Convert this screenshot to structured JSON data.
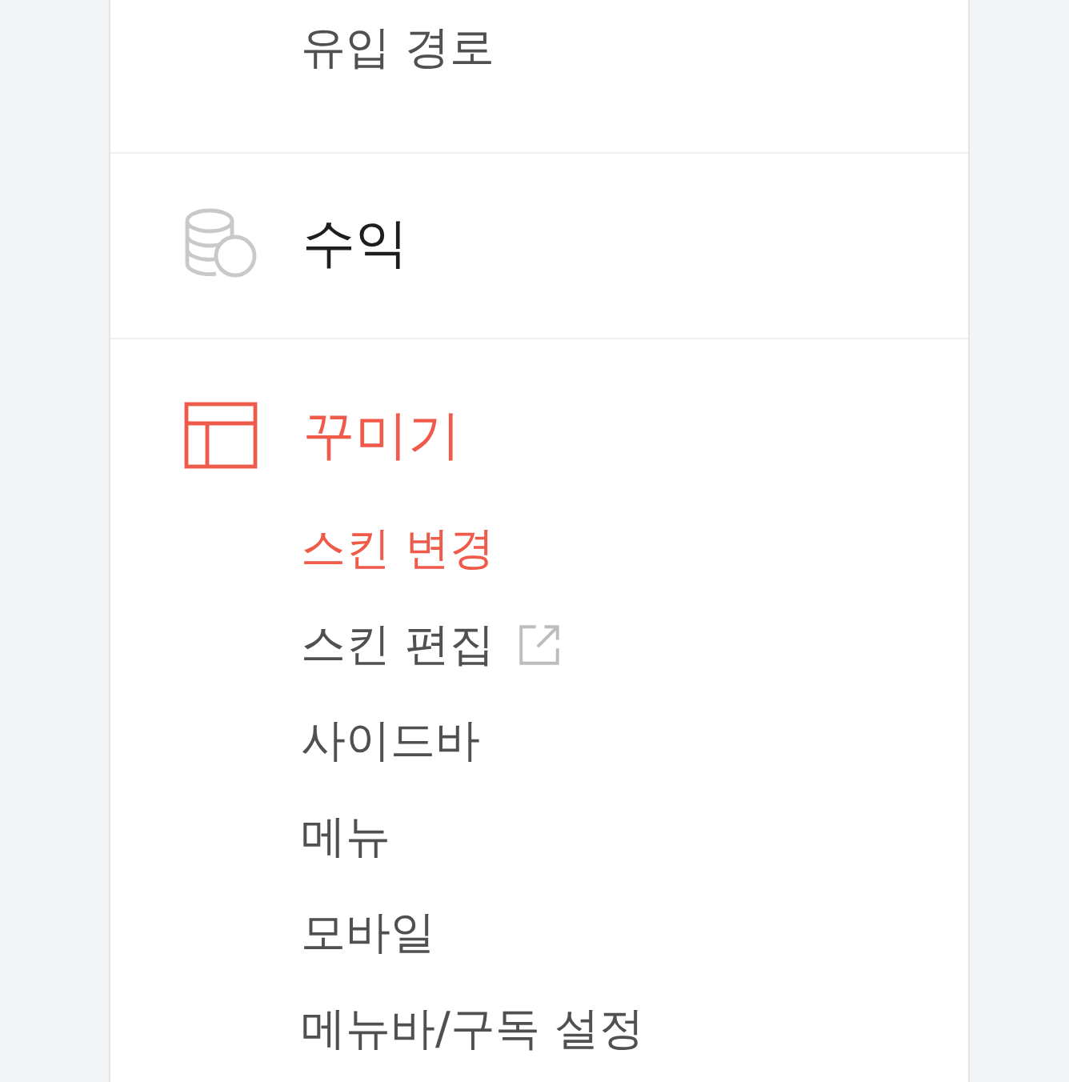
{
  "sections": [
    {
      "items": [
        {
          "label": "유입 경로",
          "selected": false,
          "external": false
        }
      ]
    },
    {
      "kind": "revenue",
      "title": "수익",
      "selected": false
    },
    {
      "kind": "design",
      "title": "꾸미기",
      "selected": true,
      "items": [
        {
          "label": "스킨 변경",
          "selected": true,
          "external": false
        },
        {
          "label": "스킨 편집",
          "selected": false,
          "external": true
        },
        {
          "label": "사이드바",
          "selected": false,
          "external": false
        },
        {
          "label": "메뉴",
          "selected": false,
          "external": false
        },
        {
          "label": "모바일",
          "selected": false,
          "external": false
        },
        {
          "label": "메뉴바/구독 설정",
          "selected": false,
          "external": false
        }
      ]
    }
  ]
}
